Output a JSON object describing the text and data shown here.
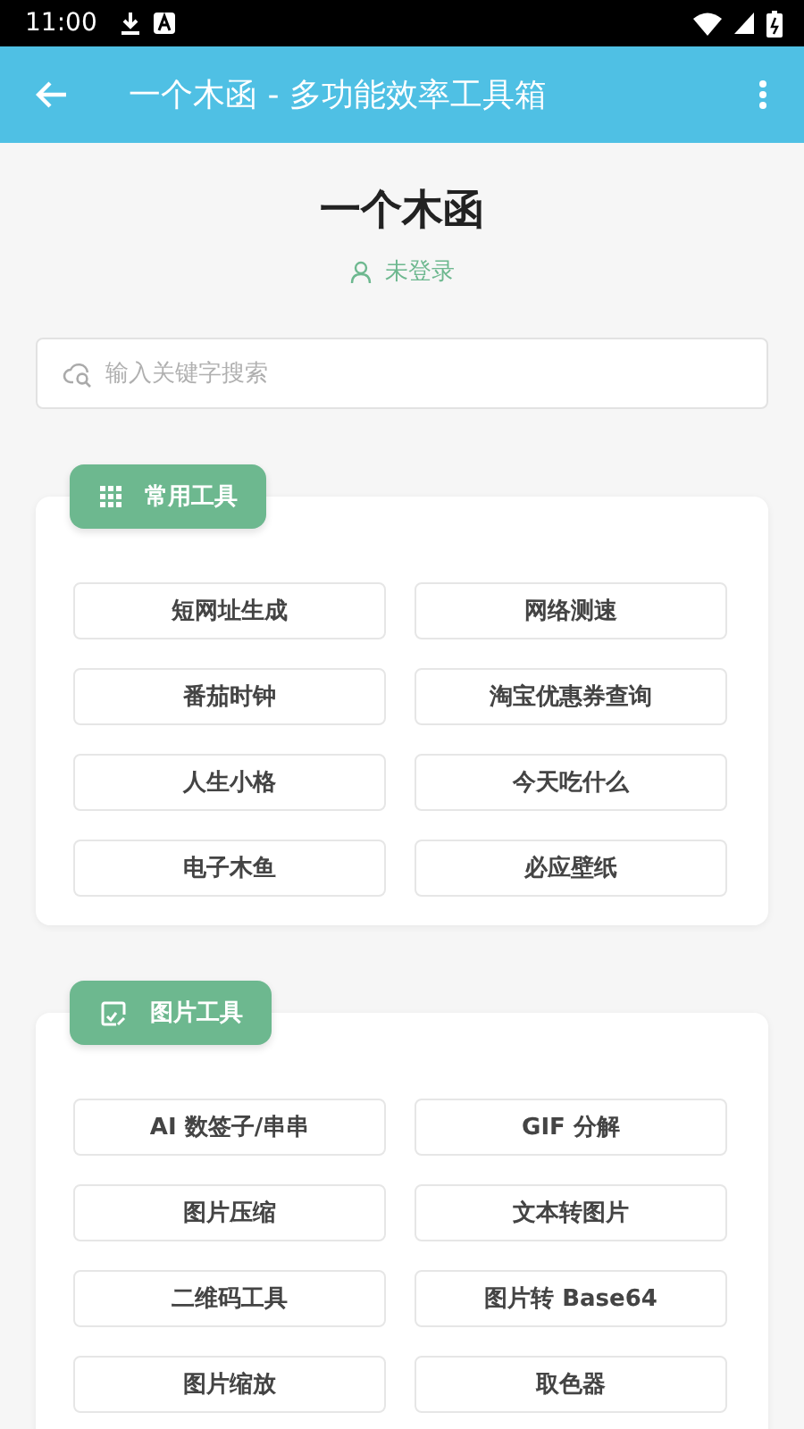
{
  "status_bar": {
    "time": "11:00"
  },
  "app_bar": {
    "title": "一个木函 - 多功能效率工具箱"
  },
  "header": {
    "title": "一个木函",
    "login_status": "未登录"
  },
  "search": {
    "placeholder": "输入关键字搜索"
  },
  "sections": [
    {
      "kind": "grid",
      "title": "常用工具",
      "tools": [
        "短网址生成",
        "网络测速",
        "番茄时钟",
        "淘宝优惠券查询",
        "人生小格",
        "今天吃什么",
        "电子木鱼",
        "必应壁纸"
      ]
    },
    {
      "kind": "image",
      "title": "图片工具",
      "tools": [
        "AI 数签子/串串",
        "GIF 分解",
        "图片压缩",
        "文本转图片",
        "二维码工具",
        "图片转 Base64",
        "图片缩放",
        "取色器"
      ]
    }
  ]
}
